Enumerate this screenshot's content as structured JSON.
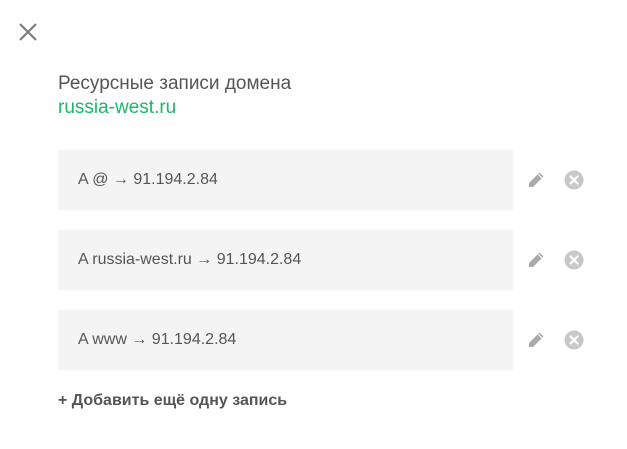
{
  "dialog": {
    "title": "Ресурсные записи домена",
    "domain": "russia-west.ru",
    "accent_color": "#1db56a"
  },
  "records": [
    {
      "text": "A @ → 91.194.2.84"
    },
    {
      "text": "A russia-west.ru → 91.194.2.84"
    },
    {
      "text": "A www → 91.194.2.84"
    }
  ],
  "actions": {
    "add_label": "+ Добавить ещё одну запись",
    "close_icon": "close-icon",
    "edit_icon": "pencil-icon",
    "delete_icon": "delete-circle-icon"
  }
}
